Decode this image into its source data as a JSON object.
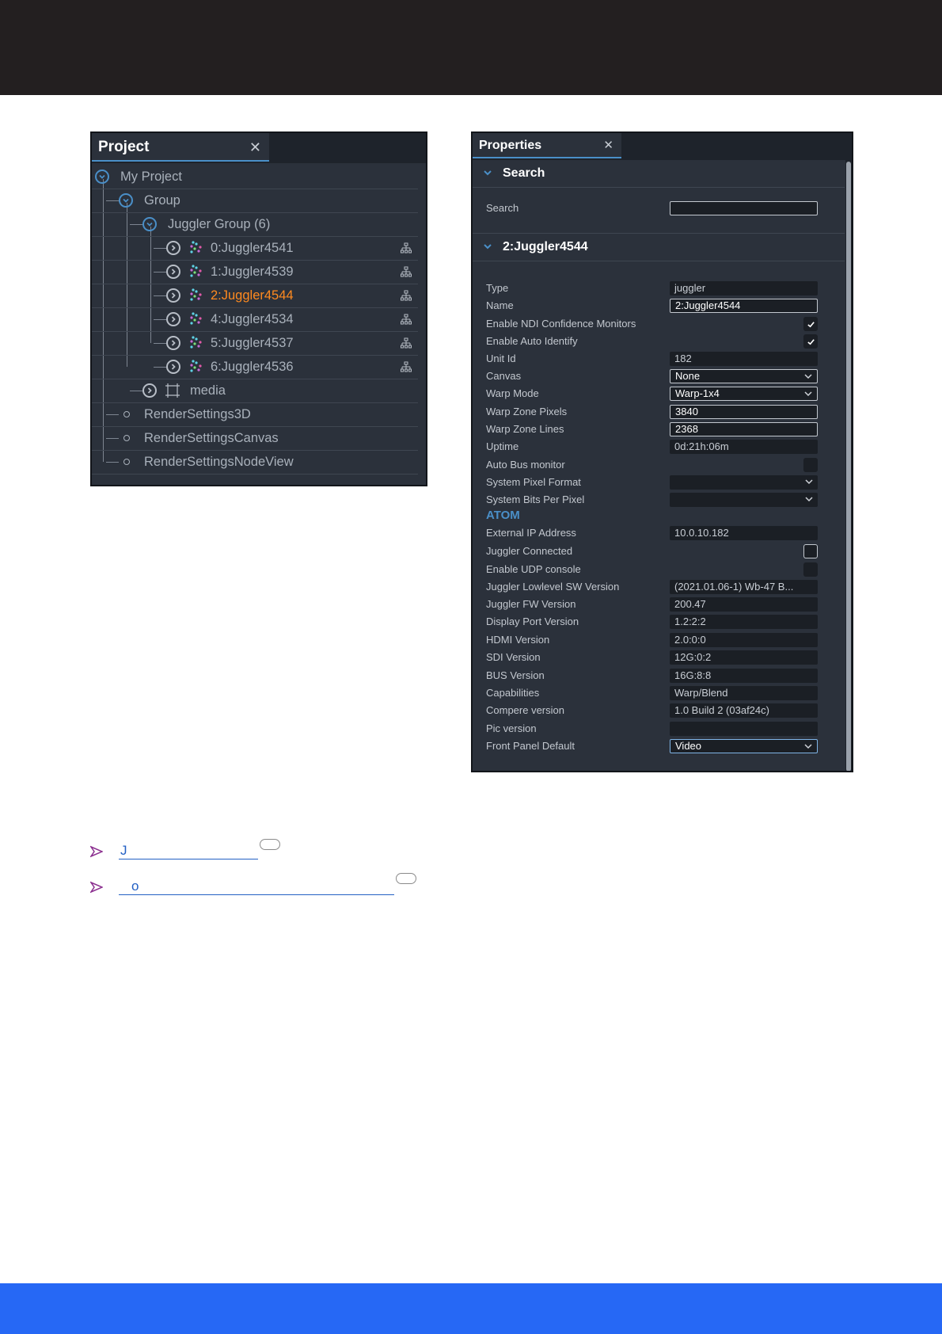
{
  "project_panel": {
    "title": "Project",
    "close_glyph": "✕",
    "tree": [
      {
        "label": "My Project",
        "icon": "chevron-down-circle-icon"
      },
      {
        "label": "Group",
        "icon": "chevron-down-circle-icon"
      },
      {
        "label": "Juggler Group (6)",
        "icon": "chevron-down-circle-icon"
      },
      {
        "label": "0:Juggler4541",
        "icon": "chevron-right-circle-icon"
      },
      {
        "label": "1:Juggler4539",
        "icon": "chevron-right-circle-icon"
      },
      {
        "label": "2:Juggler4544",
        "icon": "chevron-right-circle-icon",
        "selected": true
      },
      {
        "label": "4:Juggler4534",
        "icon": "chevron-right-circle-icon"
      },
      {
        "label": "5:Juggler4537",
        "icon": "chevron-right-circle-icon"
      },
      {
        "label": "6:Juggler4536",
        "icon": "chevron-right-circle-icon"
      },
      {
        "label": "media",
        "icon": "chevron-right-circle-icon"
      },
      {
        "label": "RenderSettings3D",
        "icon": "dot-icon"
      },
      {
        "label": "RenderSettingsCanvas",
        "icon": "dot-icon"
      },
      {
        "label": "RenderSettingsNodeView",
        "icon": "dot-icon"
      }
    ]
  },
  "properties_panel": {
    "title": "Properties",
    "close_glyph": "✕",
    "search_section": {
      "title": "Search",
      "label": "Search",
      "value": ""
    },
    "node_section": {
      "title": "2:Juggler4544"
    },
    "props": {
      "type": {
        "label": "Type",
        "value": "juggler"
      },
      "name": {
        "label": "Name",
        "value": "2:Juggler4544"
      },
      "ndi": {
        "label": "Enable NDI Confidence Monitors",
        "checked": true
      },
      "auto_identify": {
        "label": "Enable Auto Identify",
        "checked": true
      },
      "unit_id": {
        "label": "Unit Id",
        "value": "182"
      },
      "canvas": {
        "label": "Canvas",
        "value": "None"
      },
      "warp_mode": {
        "label": "Warp Mode",
        "value": "Warp-1x4"
      },
      "warp_zone_pixels": {
        "label": "Warp Zone Pixels",
        "value": "3840"
      },
      "warp_zone_lines": {
        "label": "Warp Zone Lines",
        "value": "2368"
      },
      "uptime": {
        "label": "Uptime",
        "value": "0d:21h:06m"
      },
      "auto_bus": {
        "label": "Auto Bus monitor",
        "checked": false
      },
      "pixel_format": {
        "label": "System Pixel Format",
        "value": ""
      },
      "bits_per_pixel": {
        "label": "System Bits Per Pixel",
        "value": ""
      },
      "atom_heading": "ATOM",
      "external_ip": {
        "label": "External IP Address",
        "value": "10.0.10.182"
      },
      "juggler_connected": {
        "label": "Juggler Connected",
        "checked": false
      },
      "udp_console": {
        "label": "Enable UDP console",
        "checked": false
      },
      "lowlevel_sw": {
        "label": "Juggler Lowlevel SW Version",
        "value": "(2021.01.06-1) Wb-47 B..."
      },
      "fw_version": {
        "label": "Juggler FW Version",
        "value": "200.47"
      },
      "dp_version": {
        "label": "Display Port Version",
        "value": "1.2:2:2"
      },
      "hdmi_version": {
        "label": "HDMI Version",
        "value": "2.0:0:0"
      },
      "sdi_version": {
        "label": "SDI Version",
        "value": "12G:0:2"
      },
      "bus_version": {
        "label": "BUS Version",
        "value": "16G:8:8"
      },
      "capabilities": {
        "label": "Capabilities",
        "value": "Warp/Blend"
      },
      "compere_version": {
        "label": "Compere version",
        "value": "1.0 Build 2 (03af24c)"
      },
      "pic_version": {
        "label": "Pic version",
        "value": ""
      },
      "front_panel": {
        "label": "Front Panel Default",
        "value": "Video"
      }
    },
    "dropdown_glyph": "⌄"
  },
  "links": [
    {
      "text": "J"
    },
    {
      "text": "o"
    }
  ],
  "colors": {
    "top_bar": "#231f20",
    "bottom_bar": "#2668f5",
    "panel_bg": "#2b313b",
    "accent_blue": "#4a8fc8",
    "selected_orange": "#ff8a1f",
    "link_blue": "#2360c4"
  }
}
